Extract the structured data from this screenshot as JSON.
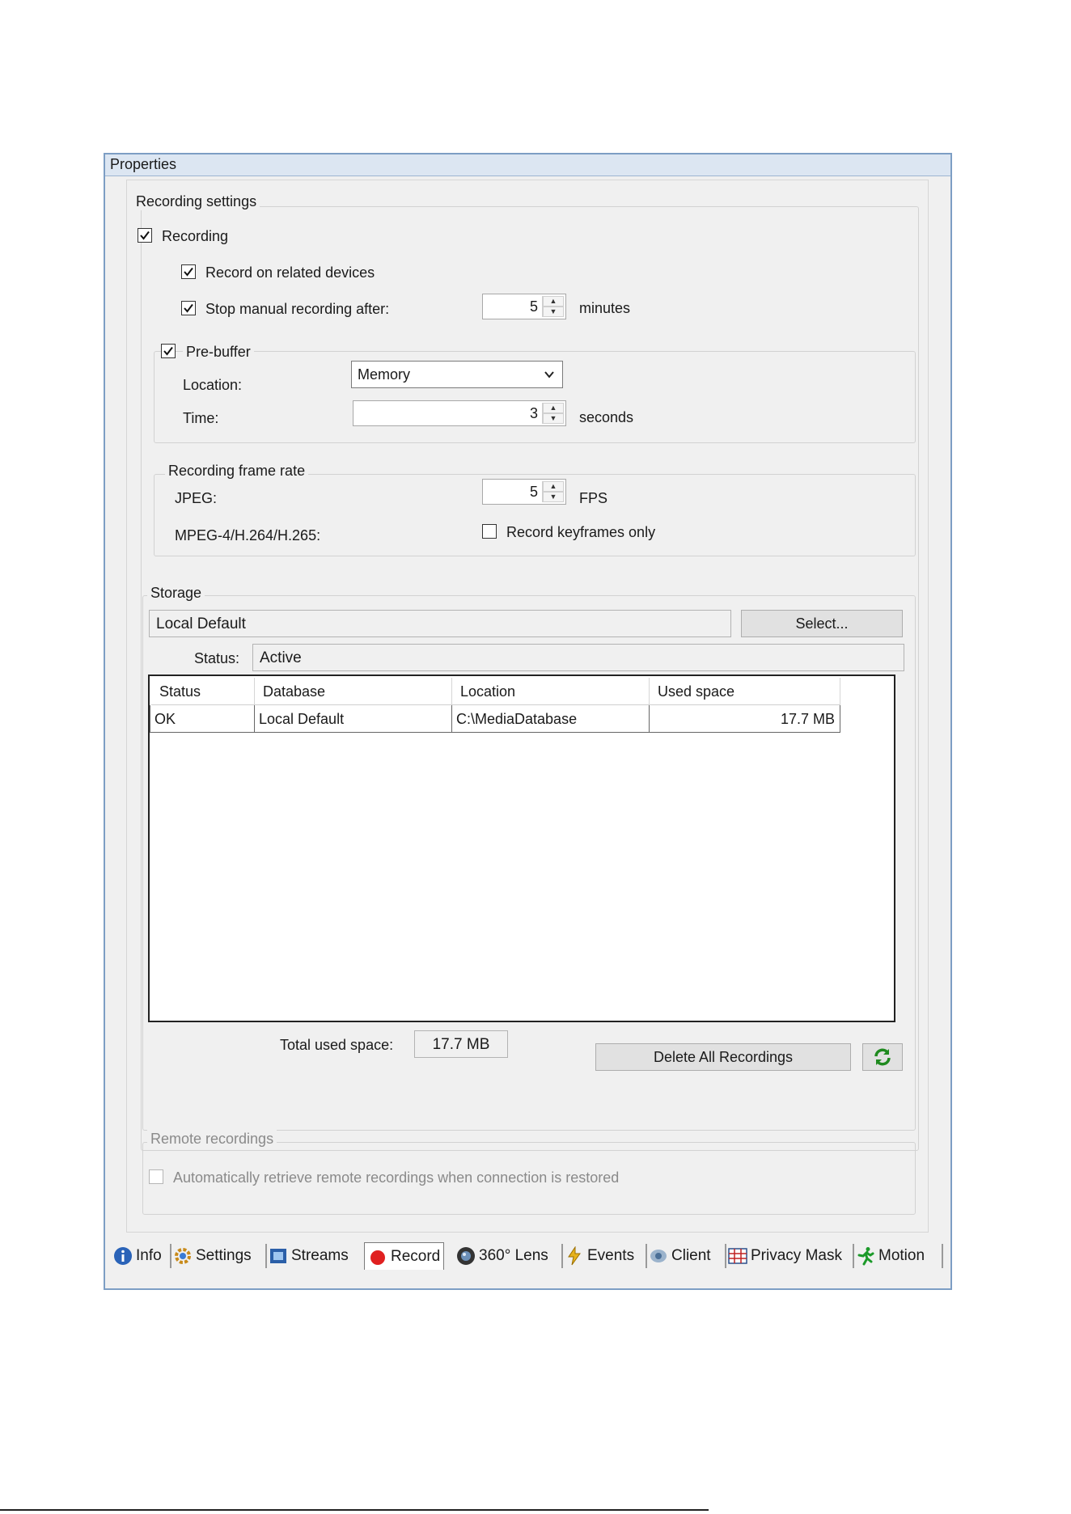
{
  "window": {
    "title": "Properties"
  },
  "recording_settings": {
    "title": "Recording settings",
    "recording": {
      "label": "Recording",
      "checked": true
    },
    "record_related": {
      "label": "Record on related devices",
      "checked": true
    },
    "stop_manual": {
      "label": "Stop manual recording after:",
      "checked": true,
      "value": "5",
      "unit": "minutes"
    },
    "prebuffer": {
      "label": "Pre-buffer",
      "checked": true,
      "location_label": "Location:",
      "location_value": "Memory",
      "time_label": "Time:",
      "time_value": "3",
      "time_unit": "seconds"
    },
    "frame_rate": {
      "title": "Recording frame rate",
      "jpeg_label": "JPEG:",
      "jpeg_value": "5",
      "jpeg_unit": "FPS",
      "mpeg_label": "MPEG-4/H.264/H.265:",
      "keyframes_label": "Record keyframes only",
      "keyframes_checked": false
    }
  },
  "storage": {
    "title": "Storage",
    "name": "Local Default",
    "select_button": "Select...",
    "status_label": "Status:",
    "status_value": "Active",
    "table": {
      "headers": [
        "Status",
        "Database",
        "Location",
        "Used space"
      ],
      "rows": [
        [
          "OK",
          "Local Default",
          "C:\\MediaDatabase",
          "17.7 MB"
        ]
      ]
    },
    "total_label": "Total used space:",
    "total_value": "17.7 MB",
    "delete_button": "Delete All Recordings"
  },
  "remote": {
    "title": "Remote recordings",
    "auto_retrieve_label": "Automatically retrieve remote recordings when connection is restored",
    "auto_retrieve_checked": false
  },
  "tabs": [
    {
      "label": "Info",
      "icon": "info-icon"
    },
    {
      "label": "Settings",
      "icon": "settings-icon"
    },
    {
      "label": "Streams",
      "icon": "streams-icon"
    },
    {
      "label": "Record",
      "icon": "record-icon",
      "active": true
    },
    {
      "label": "360° Lens",
      "icon": "lens-icon"
    },
    {
      "label": "Events",
      "icon": "events-icon"
    },
    {
      "label": "Client",
      "icon": "client-icon"
    },
    {
      "label": "Privacy Mask",
      "icon": "privacy-mask-icon"
    },
    {
      "label": "Motion",
      "icon": "motion-icon"
    }
  ],
  "colors": {
    "title_bar": "#dce6f2",
    "window_border": "#7d9ec4",
    "panel": "#f0f0f0",
    "record_red": "#e02020"
  }
}
